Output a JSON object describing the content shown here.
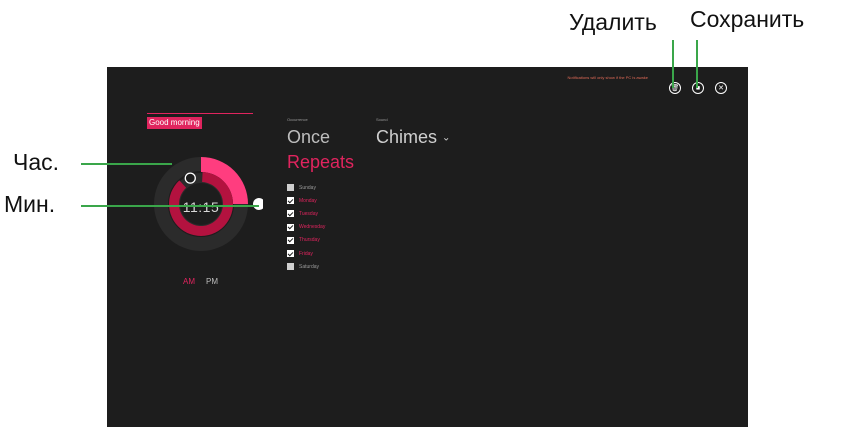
{
  "callouts": {
    "delete_label": "Удалить",
    "save_label": "Сохранить",
    "hour_label": "Час.",
    "minute_label": "Мин."
  },
  "topbar": {
    "notification": "Notifications will only show if the PC is awake",
    "delete_icon": "delete-icon",
    "save_icon": "save-icon",
    "close_icon": "close-icon"
  },
  "alarm": {
    "name": "Good morning",
    "time": "11:15",
    "hour": 11,
    "minute": 15,
    "am_label": "AM",
    "pm_label": "PM",
    "period": "AM"
  },
  "occurrence": {
    "label": "Occurrence",
    "options": [
      "Once",
      "Repeats"
    ],
    "selected": "Repeats",
    "days": [
      {
        "name": "Sunday",
        "checked": false
      },
      {
        "name": "Monday",
        "checked": true
      },
      {
        "name": "Tuesday",
        "checked": true
      },
      {
        "name": "Wednesday",
        "checked": true
      },
      {
        "name": "Thursday",
        "checked": true
      },
      {
        "name": "Friday",
        "checked": true
      },
      {
        "name": "Saturday",
        "checked": false
      }
    ]
  },
  "sound": {
    "label": "Sound",
    "value": "Chimes",
    "chevron": "chevron-down-icon"
  },
  "colors": {
    "accent": "#e0245e",
    "accent_light": "#ff3d7f",
    "accent_dark": "#b3123f",
    "background": "#1d1d1d",
    "ring_track": "#2b2b2b",
    "callout": "#3aa64a",
    "notification": "#e06a57"
  }
}
